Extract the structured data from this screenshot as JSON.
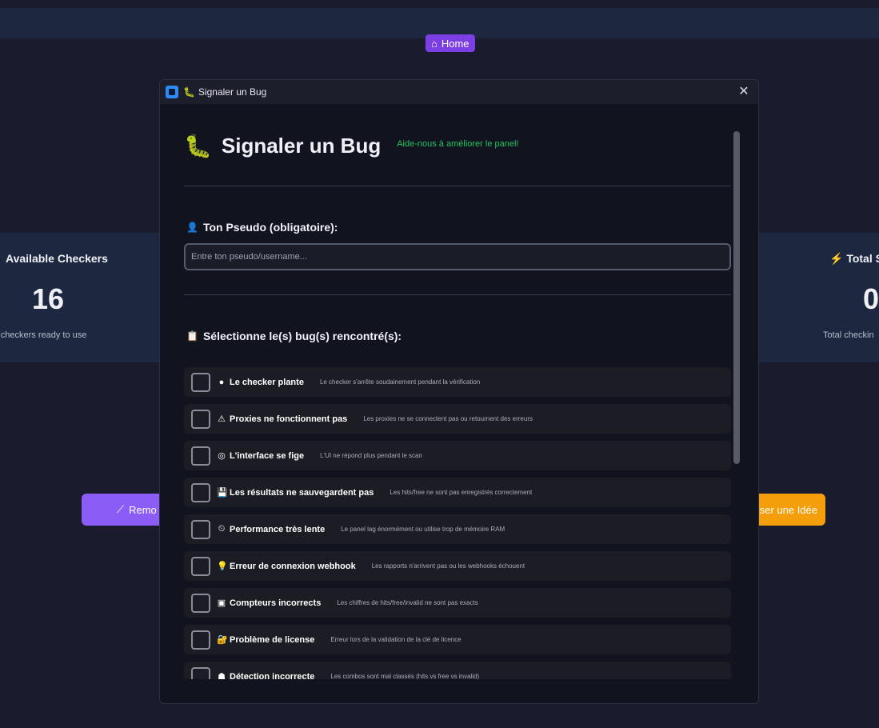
{
  "background": {
    "home_button": {
      "icon": "home-icon",
      "label": "Home"
    },
    "left_card": {
      "title": "Available Checkers",
      "value": "16",
      "subtitle": "otal checkers ready to use"
    },
    "right_card": {
      "title": "Total S",
      "value": "0",
      "subtitle": "Total checkin"
    },
    "left_button": {
      "label": "Remo"
    },
    "right_button": {
      "label": "ser une Idée"
    }
  },
  "dialog": {
    "window_title": "Signaler un Bug",
    "title_icon": "🐛",
    "heading": "Signaler un Bug",
    "heading_icon": "🐛",
    "subheading": "Aide-nous à améliorer le panel!",
    "pseudo_label": "Ton Pseudo (obligatoire):",
    "pseudo_icon": "👤",
    "pseudo_value": "",
    "pseudo_placeholder": "Entre ton pseudo/username...",
    "bugs_label": "Sélectionne le(s) bug(s) rencontré(s):",
    "bugs_icon": "📋",
    "bugs": [
      {
        "icon": "●",
        "title": "Le checker plante",
        "desc": "Le checker s'arrête soudainement pendant la vérification",
        "checked": false
      },
      {
        "icon": "⚠",
        "title": "Proxies ne fonctionnent pas",
        "desc": "Les proxies ne se connectent pas ou retournent des erreurs",
        "checked": false
      },
      {
        "icon": "◎",
        "title": "L'interface se fige",
        "desc": "L'UI ne répond plus pendant le scan",
        "checked": false
      },
      {
        "icon": "💾",
        "title": "Les résultats ne sauvegardent pas",
        "desc": "Les hits/free ne sont pas enregistrés correctement",
        "checked": false
      },
      {
        "icon": "⏲",
        "title": "Performance très lente",
        "desc": "Le panel lag énormément ou utilise trop de mémoire RAM",
        "checked": false
      },
      {
        "icon": "💡",
        "title": "Erreur de connexion webhook",
        "desc": "Les rapports n'arrivent pas ou les webhooks échouent",
        "checked": false
      },
      {
        "icon": "▣",
        "title": "Compteurs incorrects",
        "desc": "Les chiffres de hits/free/invalid ne sont pas exacts",
        "checked": false
      },
      {
        "icon": "🔐",
        "title": "Problème de license",
        "desc": "Erreur lors de la validation de la clé de licence",
        "checked": false
      },
      {
        "icon": "☗",
        "title": "Détection incorrecte",
        "desc": "Les combos sont mal classés (hits vs free vs invalid)",
        "checked": false
      }
    ]
  }
}
